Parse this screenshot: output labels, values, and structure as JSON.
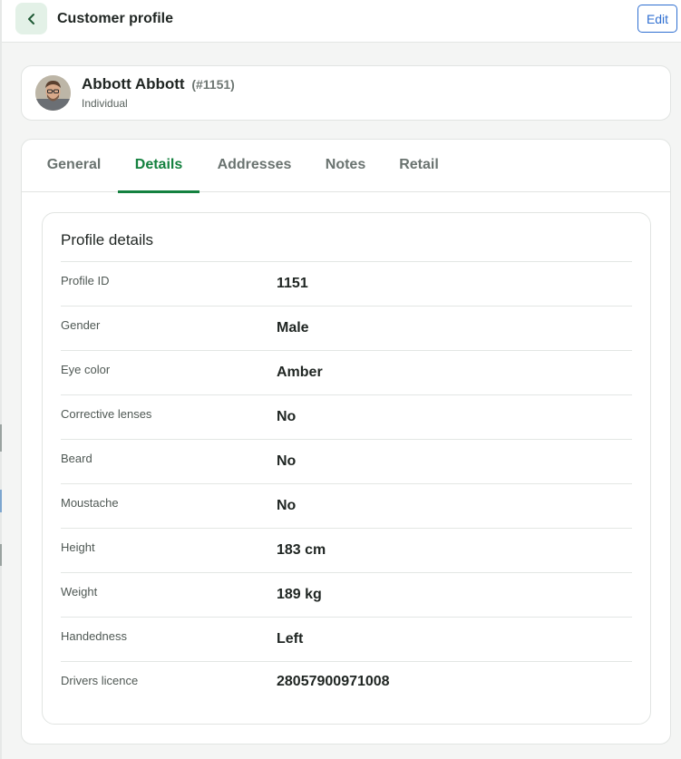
{
  "header": {
    "title": "Customer profile",
    "back_icon": "chevron-left-icon",
    "edit_label": "Edit"
  },
  "customer": {
    "name": "Abbott Abbott",
    "number": "(#1151)",
    "type": "Individual"
  },
  "tabs": [
    {
      "label": "General",
      "active": false
    },
    {
      "label": "Details",
      "active": true
    },
    {
      "label": "Addresses",
      "active": false
    },
    {
      "label": "Notes",
      "active": false
    },
    {
      "label": "Retail",
      "active": false
    }
  ],
  "profile": {
    "title": "Profile details",
    "rows": [
      {
        "label": "Profile ID",
        "value": "1151"
      },
      {
        "label": "Gender",
        "value": "Male"
      },
      {
        "label": "Eye color",
        "value": "Amber"
      },
      {
        "label": "Corrective lenses",
        "value": "No"
      },
      {
        "label": "Beard",
        "value": "No"
      },
      {
        "label": "Moustache",
        "value": "No"
      },
      {
        "label": "Height",
        "value": "183 cm"
      },
      {
        "label": "Weight",
        "value": "189 kg"
      },
      {
        "label": "Handedness",
        "value": "Left"
      },
      {
        "label": "Drivers licence",
        "value": "28057900971008"
      }
    ]
  },
  "colors": {
    "accent_green": "#14813f",
    "edit_blue": "#2f6fd1",
    "back_button_bg": "#e3f1e7"
  }
}
